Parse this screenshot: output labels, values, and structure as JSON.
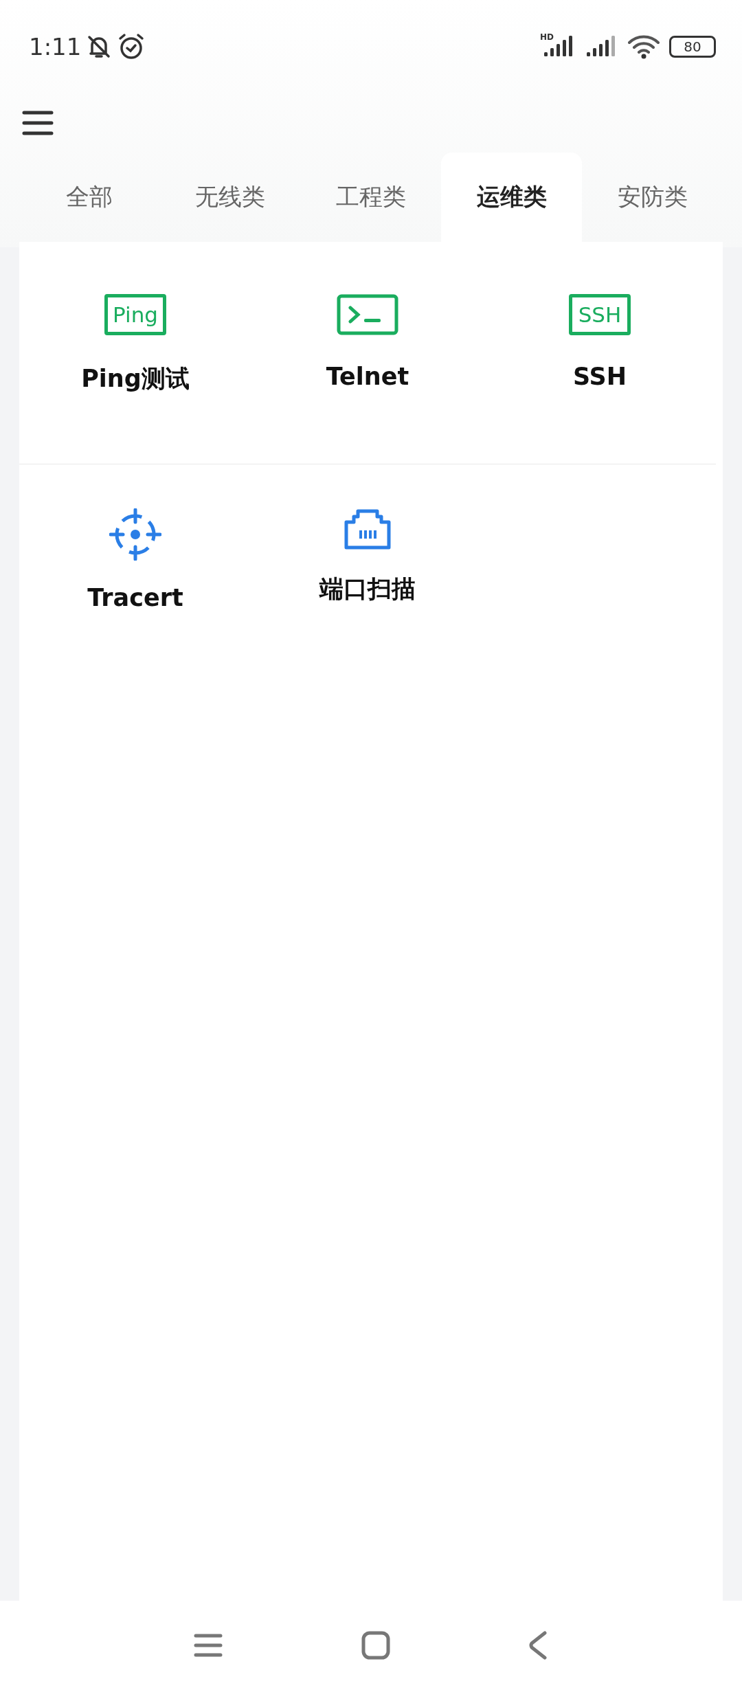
{
  "status_bar": {
    "time": "1:11",
    "network": "HD",
    "battery": "80"
  },
  "tabs": [
    {
      "label": "全部",
      "selected": false
    },
    {
      "label": "无线类",
      "selected": false
    },
    {
      "label": "工程类",
      "selected": false
    },
    {
      "label": "运维类",
      "selected": true
    },
    {
      "label": "安防类",
      "selected": false
    }
  ],
  "tools": [
    [
      {
        "kind": "text",
        "icon_text": "Ping",
        "label": "Ping测试"
      },
      {
        "kind": "terminal",
        "label": "Telnet"
      },
      {
        "kind": "text",
        "icon_text": "SSH",
        "label": "SSH"
      }
    ],
    [
      {
        "kind": "target",
        "label": "Tracert"
      },
      {
        "kind": "port",
        "label": "端口扫描"
      }
    ]
  ]
}
